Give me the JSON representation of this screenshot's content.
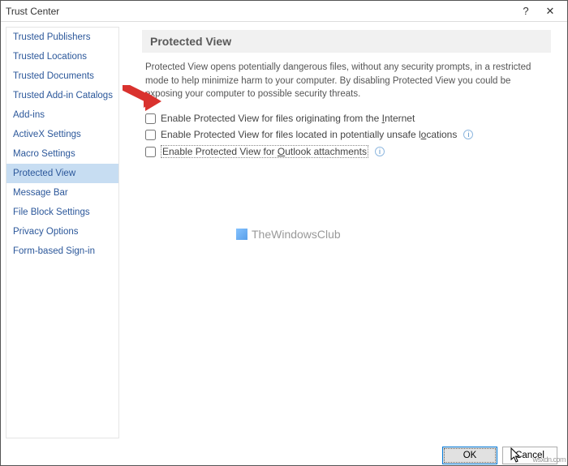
{
  "titlebar": {
    "title": "Trust Center",
    "help": "?",
    "close": "✕"
  },
  "sidebar": {
    "items": [
      {
        "label": "Trusted Publishers"
      },
      {
        "label": "Trusted Locations"
      },
      {
        "label": "Trusted Documents"
      },
      {
        "label": "Trusted Add-in Catalogs"
      },
      {
        "label": "Add-ins"
      },
      {
        "label": "ActiveX Settings"
      },
      {
        "label": "Macro Settings"
      },
      {
        "label": "Protected View"
      },
      {
        "label": "Message Bar"
      },
      {
        "label": "File Block Settings"
      },
      {
        "label": "Privacy Options"
      },
      {
        "label": "Form-based Sign-in"
      }
    ],
    "selected_index": 7
  },
  "main": {
    "section_title": "Protected View",
    "description": "Protected View opens potentially dangerous files, without any security prompts, in a restricted mode to help minimize harm to your computer. By disabling Protected View you could be exposing your computer to possible security threats.",
    "options": [
      {
        "pre": "Enable Protected View for files originating from the ",
        "uchar": "I",
        "post": "nternet",
        "info": false,
        "checked": false
      },
      {
        "pre": "Enable Protected View for files located in potentially unsafe l",
        "uchar": "o",
        "post": "cations",
        "info": true,
        "checked": false
      },
      {
        "pre": "Enable Protected View for ",
        "uchar": "O",
        "post": "utlook attachments",
        "info": true,
        "checked": false
      }
    ]
  },
  "watermark": "TheWindowsClub",
  "footer": {
    "ok": "OK",
    "cancel": "Cancel"
  },
  "corner": "wsxdn.com"
}
